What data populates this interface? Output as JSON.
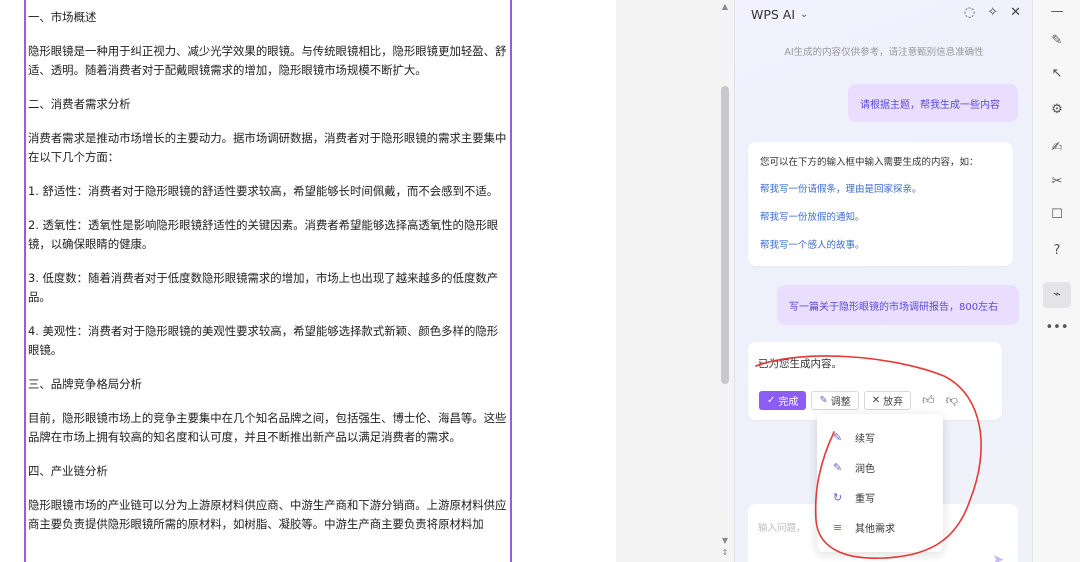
{
  "document": {
    "paragraphs": [
      "一、市场概述",
      "隐形眼镜是一种用于纠正视力、减少光学效果的眼镜。与传统眼镜相比，隐形眼镜更加轻盈、舒适、透明。随着消费者对于配戴眼镜需求的增加，隐形眼镜市场规模不断扩大。",
      "二、消费者需求分析",
      "消费者需求是推动市场增长的主要动力。据市场调研数据，消费者对于隐形眼镜的需求主要集中在以下几个方面：",
      "1. 舒适性：消费者对于隐形眼镜的舒适性要求较高，希望能够长时间佩戴，而不会感到不适。",
      "2. 透氧性：透氧性是影响隐形眼镜舒适性的关键因素。消费者希望能够选择高透氧性的隐形眼镜，以确保眼睛的健康。",
      "3. 低度数：随着消费者对于低度数隐形眼镜需求的增加，市场上也出现了越来越多的低度数产品。",
      "4. 美观性：消费者对于隐形眼镜的美观性要求较高，希望能够选择款式新颖、颜色多样的隐形眼镜。",
      "三、品牌竞争格局分析",
      "目前，隐形眼镜市场上的竞争主要集中在几个知名品牌之间，包括强生、博士伦、海昌等。这些品牌在市场上拥有较高的知名度和认可度，并且不断推出新产品以满足消费者的需求。",
      "四、产业链分析",
      "隐形眼镜市场的产业链可以分为上游原材料供应商、中游生产商和下游分销商。上游原材料供应商主要负责提供隐形眼镜所需的原材料，如树脂、凝胶等。中游生产商主要负责将原材料加"
    ]
  },
  "ai_panel": {
    "title": "WPS AI",
    "disclaimer": "AI生成的内容仅供参考，请注意甄别信息准确性",
    "user_message_1": "请根据主题，帮我生成一些内容",
    "suggestion_intro": "您可以在下方的输入框中输入需要生成的内容，如：",
    "suggestions": [
      "帮我写一份请假条，理由是回家探亲。",
      "帮我写一份放假的通知。",
      "帮我写一个感人的故事。"
    ],
    "user_message_2": "写一篇关于隐形眼镜的市场调研报告，800左右",
    "result_text": "已为您生成内容。",
    "actions": {
      "done": "完成",
      "adjust": "调整",
      "discard": "放弃"
    },
    "adjust_menu": [
      {
        "icon": "pen-plus-icon",
        "glyph": "✎",
        "label": "续写"
      },
      {
        "icon": "pen-sparkle-icon",
        "glyph": "✎",
        "label": "润色"
      },
      {
        "icon": "rewrite-icon",
        "glyph": "↻",
        "label": "重写"
      },
      {
        "icon": "list-icon",
        "glyph": "≡",
        "label": "其他需求"
      }
    ],
    "input_placeholder": "输入问题，"
  },
  "colors": {
    "accent": "#8b5cf6",
    "link": "#3a6bd1",
    "annotation": "#e53935"
  }
}
